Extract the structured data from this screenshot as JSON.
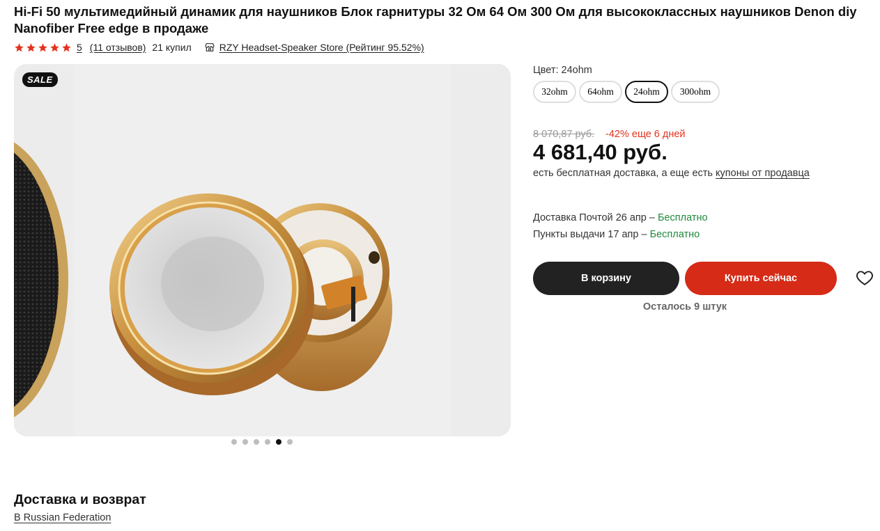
{
  "product": {
    "title": "Hi-Fi 50 мультимедийный динамик для наушников Блок гарнитуры 32 Ом 64 Ом 300 Ом для высококлассных наушников Denon diy Nanofiber Free edge в продаже",
    "rating": "5",
    "reviews": "(11 отзывов)",
    "bought": "21 купил",
    "store": "RZY Headset-Speaker Store (Рейтинг 95.52%)",
    "star_count": 5,
    "star_color": "#e2331d"
  },
  "gallery": {
    "badge": "SALE",
    "slide_count": 6,
    "active_slide": 5
  },
  "variants": {
    "label": "Цвет: 24ohm",
    "options": [
      "32ohm",
      "64ohm",
      "24ohm",
      "300ohm"
    ],
    "selected": "24ohm"
  },
  "pricing": {
    "old_price": "8 070,87 руб.",
    "discount": "-42% еще 6 дней",
    "price": "4 681,40 руб.",
    "shipping_text": "есть бесплатная доставка, а еще есть",
    "coupon_link": "купоны от продавца"
  },
  "delivery": {
    "post_text": "Доставка Почтой 26 апр – ",
    "post_free": "Бесплатно",
    "pickup_text": "Пункты выдачи 17 апр – ",
    "pickup_free": "Бесплатно"
  },
  "actions": {
    "cart": "В корзину",
    "buy": "Купить сейчас",
    "stock": "Осталось 9 штук",
    "buy_color": "#d52b17",
    "cart_color": "#222222"
  },
  "footer": {
    "section_title": "Доставка и возврат",
    "region_link": "В Russian Federation"
  }
}
